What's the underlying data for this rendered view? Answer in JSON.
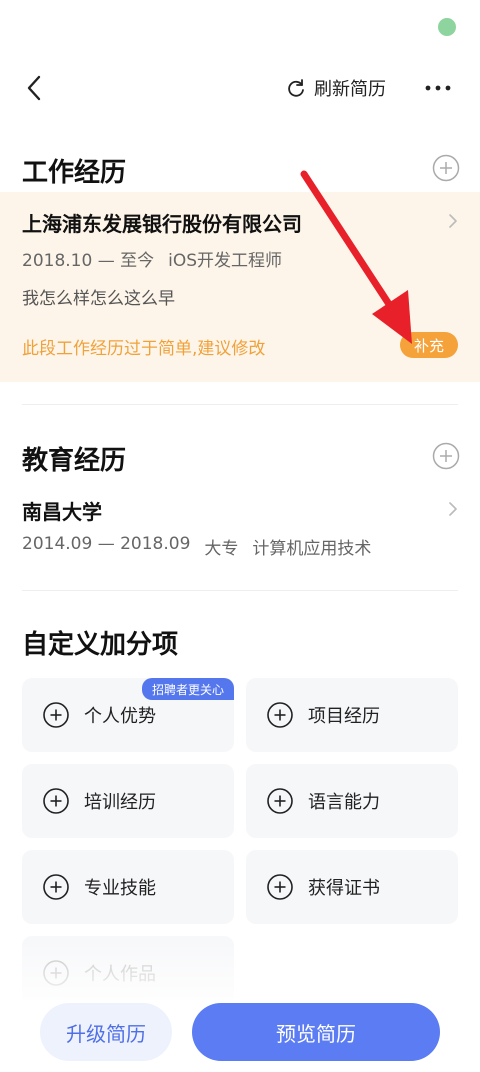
{
  "header": {
    "refresh_label": "刷新简历"
  },
  "work": {
    "title": "工作经历",
    "company": "上海浦东发展银行股份有限公司",
    "period": "2018.10 — 至今",
    "position": "iOS开发工程师",
    "description": "我怎么样怎么这么早",
    "tip": "此段工作经历过于简单,建议修改",
    "supplement_label": "补充"
  },
  "education": {
    "title": "教育经历",
    "school": "南昌大学",
    "period": "2014.09 — 2018.09",
    "degree": "大专",
    "major": "计算机应用技术"
  },
  "custom": {
    "title": "自定义加分项",
    "badge": "招聘者更关心",
    "items": [
      {
        "label": "个人优势"
      },
      {
        "label": "项目经历"
      },
      {
        "label": "培训经历"
      },
      {
        "label": "语言能力"
      },
      {
        "label": "专业技能"
      },
      {
        "label": "获得证书"
      },
      {
        "label": "个人作品"
      }
    ]
  },
  "bottom": {
    "upgrade_label": "升级简历",
    "preview_label": "预览简历"
  },
  "colors": {
    "accent": "#5b7cf2",
    "warning": "#f5a23a",
    "annotation": "#e8202a"
  }
}
